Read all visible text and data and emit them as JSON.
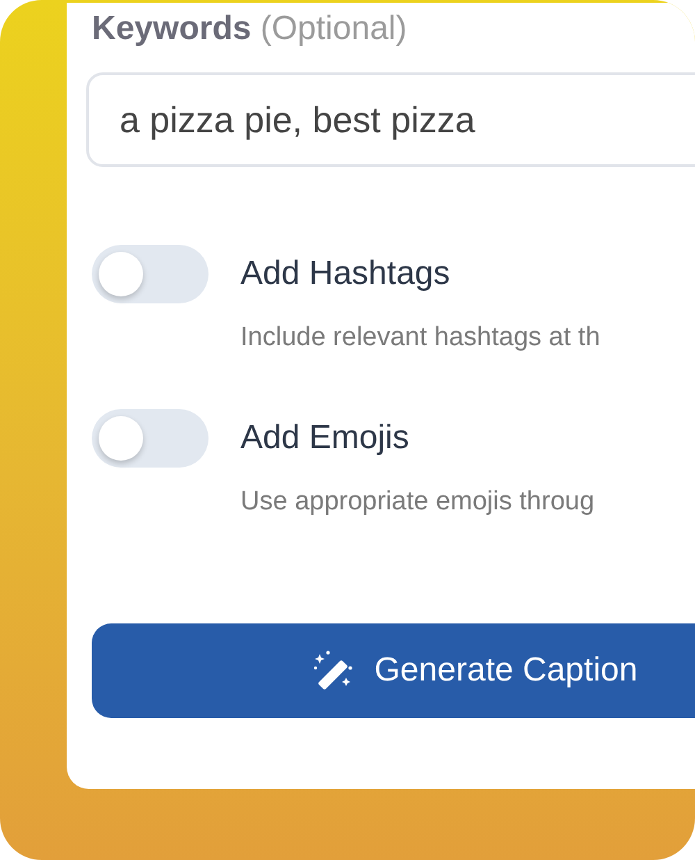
{
  "keywords": {
    "label": "Keywords",
    "hint": "(Optional)",
    "value": "a pizza pie, best pizza"
  },
  "options": [
    {
      "title": "Add Hashtags",
      "description": "Include relevant hashtags at th",
      "on": false
    },
    {
      "title": "Add Emojis",
      "description": "Use appropriate emojis throug",
      "on": false
    }
  ],
  "button": {
    "label": "Generate Caption"
  }
}
